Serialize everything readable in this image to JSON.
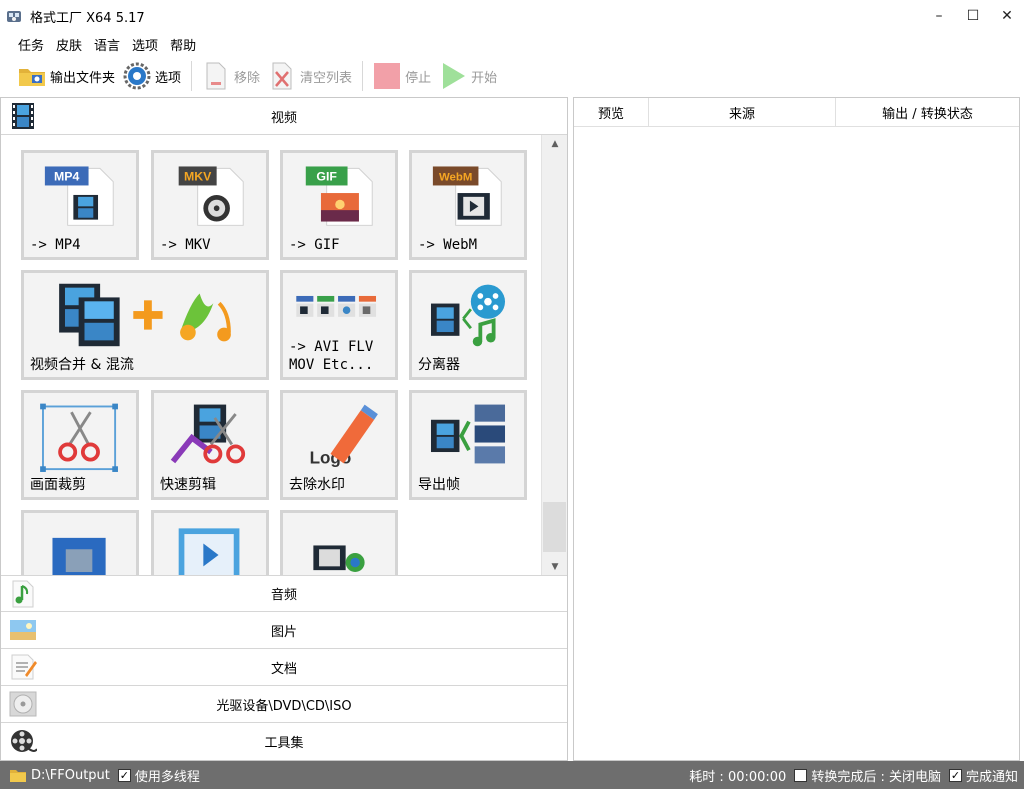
{
  "window": {
    "title": "格式工厂 X64 5.17",
    "minimize": "–",
    "maximize": "☐",
    "close": "✕"
  },
  "menu": [
    "任务",
    "皮肤",
    "语言",
    "选项",
    "帮助"
  ],
  "toolbar": {
    "output_folder": "输出文件夹",
    "options": "选项",
    "remove": "移除",
    "clear_list": "清空列表",
    "stop": "停止",
    "start": "开始"
  },
  "categories": {
    "video": "视频",
    "audio": "音频",
    "image": "图片",
    "document": "文档",
    "optical": "光驱设备\\DVD\\CD\\ISO",
    "tools": "工具集"
  },
  "tiles": {
    "mp4": {
      "badge": "MP4",
      "label": "-> MP4"
    },
    "mkv": {
      "badge": "MKV",
      "label": "-> MKV"
    },
    "gif": {
      "badge": "GIF",
      "label": "-> GIF"
    },
    "webm": {
      "badge": "WebM",
      "label": "-> WebM"
    },
    "merge": {
      "label": "视频合并 & 混流"
    },
    "avi": {
      "label": "-> AVI FLV\nMOV Etc..."
    },
    "splitter": {
      "label": "分离器"
    },
    "crop": {
      "label": "画面裁剪"
    },
    "quick_cut": {
      "label": "快速剪辑"
    },
    "watermark": {
      "label": "去除水印",
      "logo_text": "Logo"
    },
    "export_frames": {
      "label": "导出帧"
    }
  },
  "task_columns": [
    "预览",
    "来源",
    "输出 / 转换状态"
  ],
  "status": {
    "output_path": "D:\\FFOutput",
    "multithread": "使用多线程",
    "elapsed": "耗时 : 00:00:00",
    "after_done": "转换完成后 : 关闭电脑",
    "notify": "完成通知"
  },
  "colors": {
    "mp4_badge": "#3c6bb8",
    "mkv_badge": "#444444",
    "gif_badge": "#39a04a",
    "webm_badge": "#7a4a2a",
    "status_bar": "#6e6e6e"
  }
}
